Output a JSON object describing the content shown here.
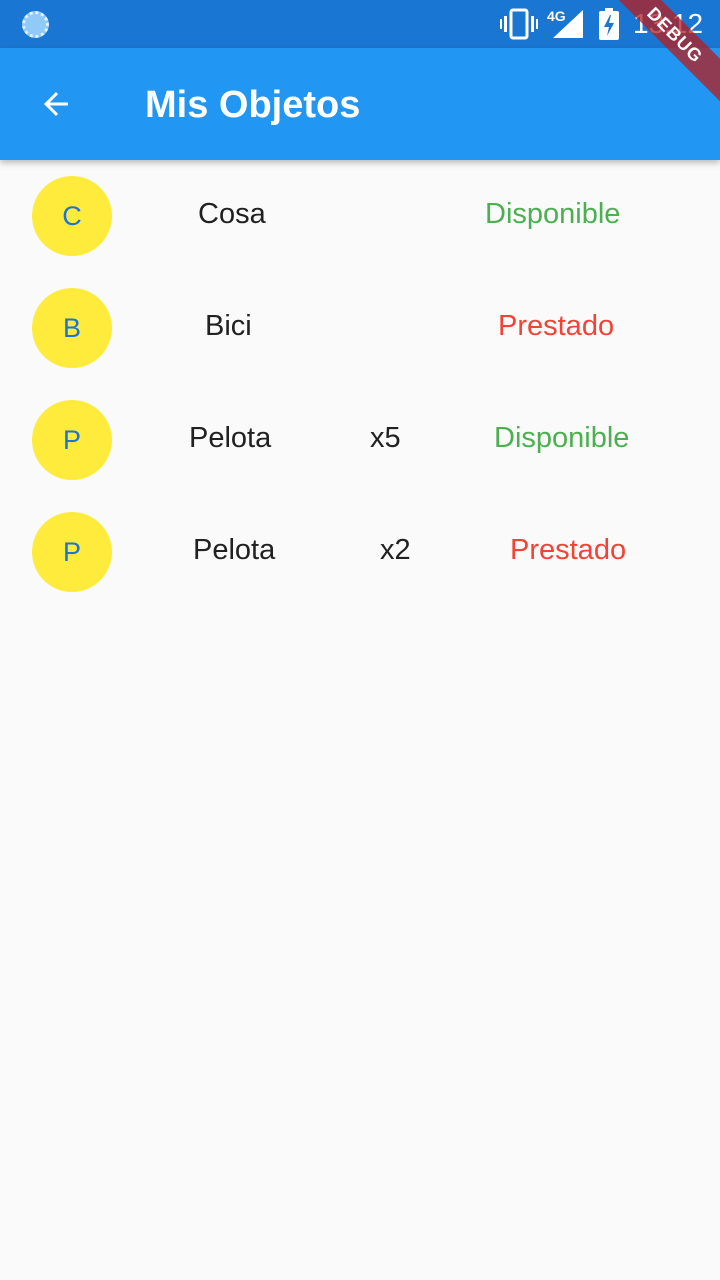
{
  "status_bar": {
    "network_label": "4G",
    "time": "13:12",
    "icons": [
      "loading-icon",
      "vibrate-icon",
      "signal-icon",
      "battery-charging-icon"
    ]
  },
  "debug_banner": "DEBUG",
  "app_bar": {
    "back_icon": "arrow-back-icon",
    "title": "Mis Objetos"
  },
  "colors": {
    "app_bar": "#2196f3",
    "status_bar": "#1976d2",
    "avatar_bg": "#ffeb3b",
    "avatar_text": "#1976d2",
    "available": "#4caf50",
    "lent": "#f44336"
  },
  "items": [
    {
      "initial": "C",
      "name": "Cosa",
      "quantity": "",
      "status": "Disponible"
    },
    {
      "initial": "B",
      "name": "Bici",
      "quantity": "",
      "status": "Prestado"
    },
    {
      "initial": "P",
      "name": "Pelota",
      "quantity": "x5",
      "status": "Disponible"
    },
    {
      "initial": "P",
      "name": "Pelota",
      "quantity": "x2",
      "status": "Prestado"
    }
  ]
}
